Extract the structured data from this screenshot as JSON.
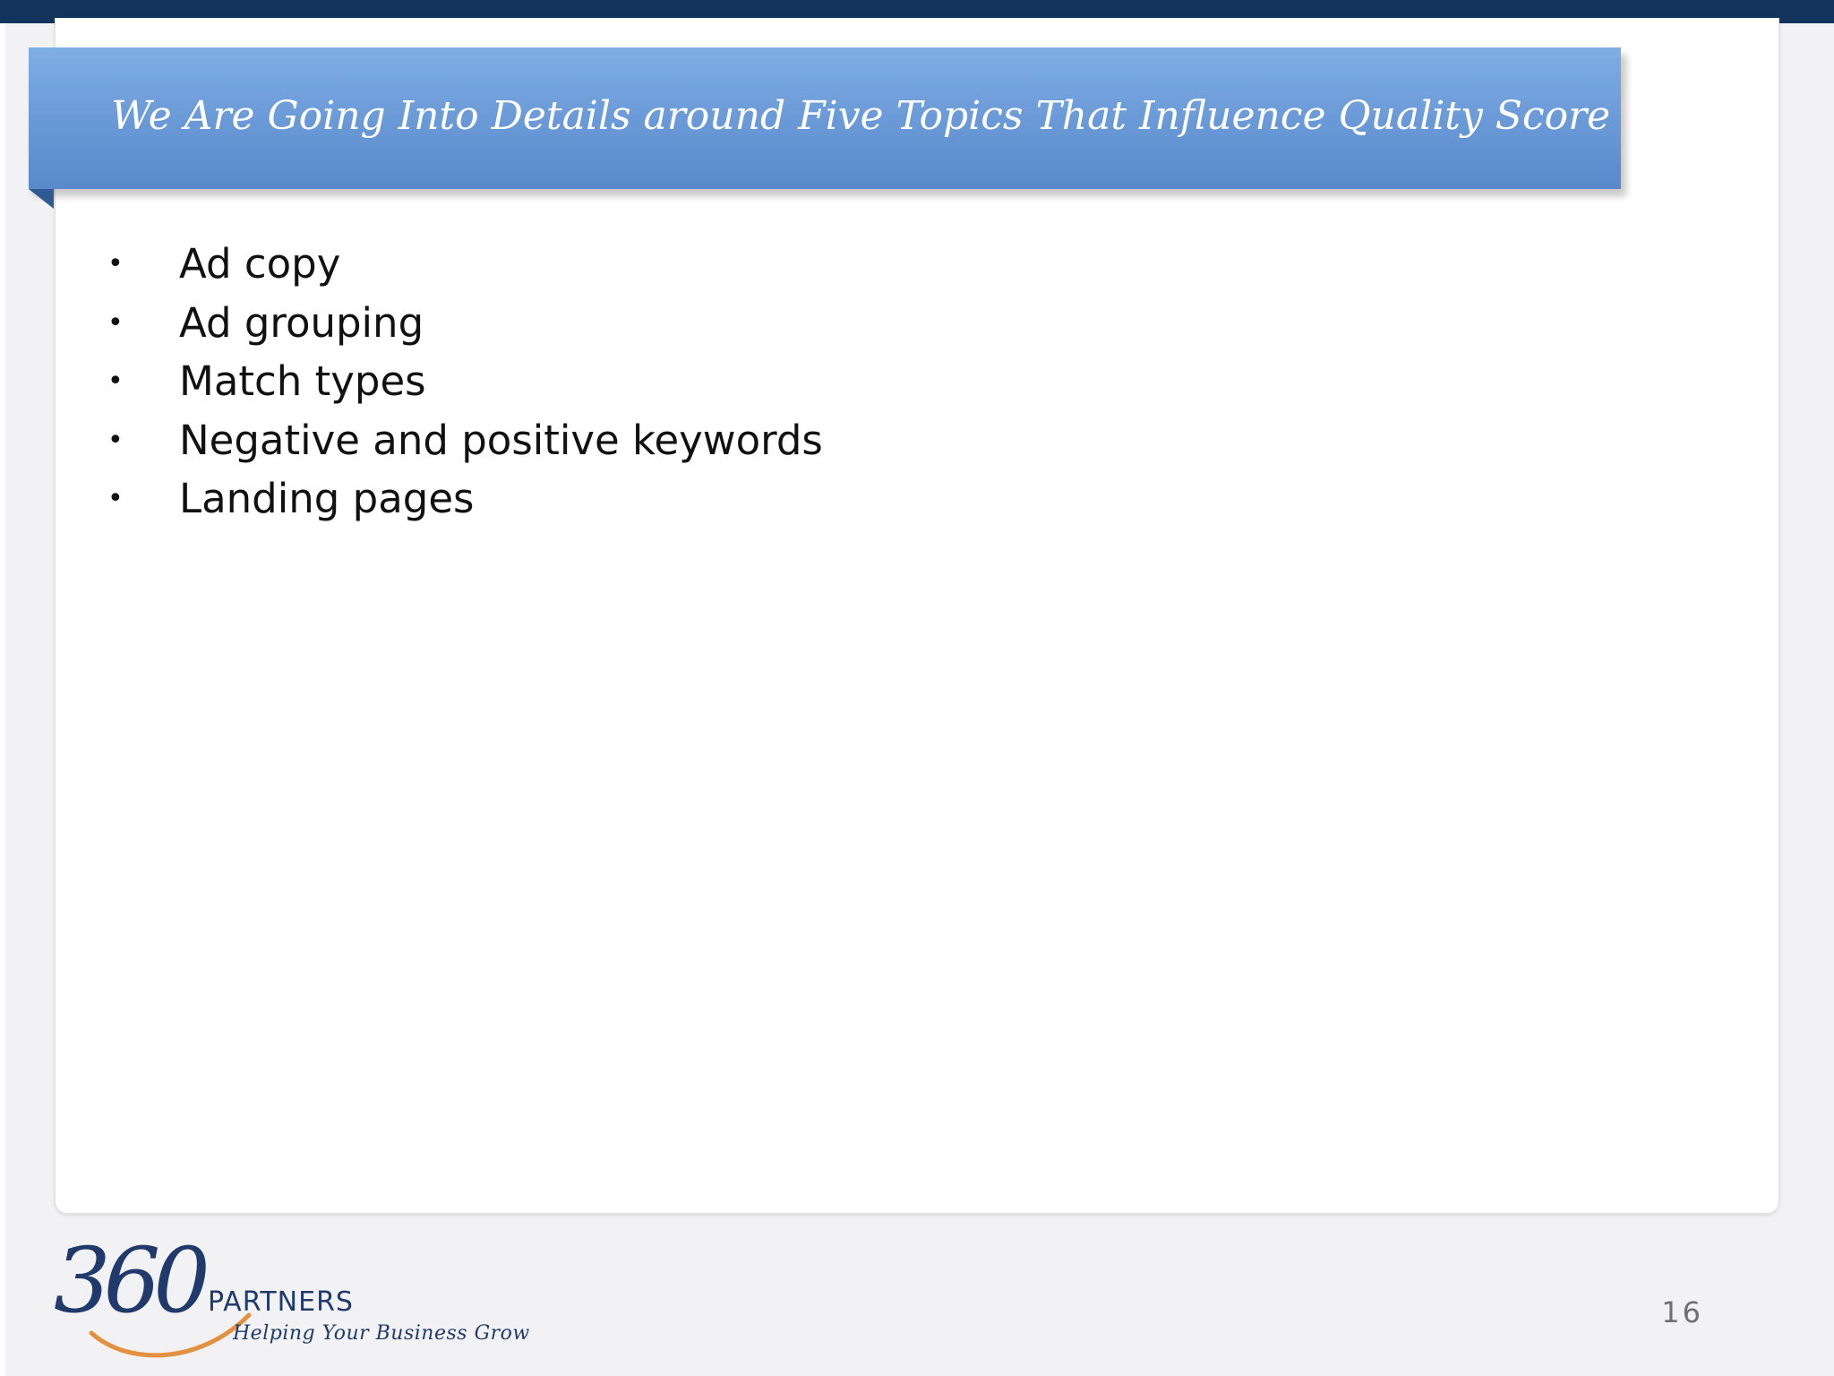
{
  "slide": {
    "title": "We Are Going Into Details around Five Topics That Influence Quality Score",
    "bullets": [
      "Ad copy",
      "Ad grouping",
      "Match types",
      "Negative and positive keywords",
      "Landing pages"
    ],
    "bullet_glyph": "•",
    "page_number": "16"
  },
  "logo": {
    "number": "360",
    "name": "PARTNERS",
    "tagline": "Helping Your Business Grow"
  },
  "colors": {
    "top_bar": "#12345c",
    "banner_top": "#7eaee2",
    "banner_bottom": "#5a89cc",
    "logo_blue": "#1f3a6b",
    "logo_swoosh": "#e3913f"
  }
}
